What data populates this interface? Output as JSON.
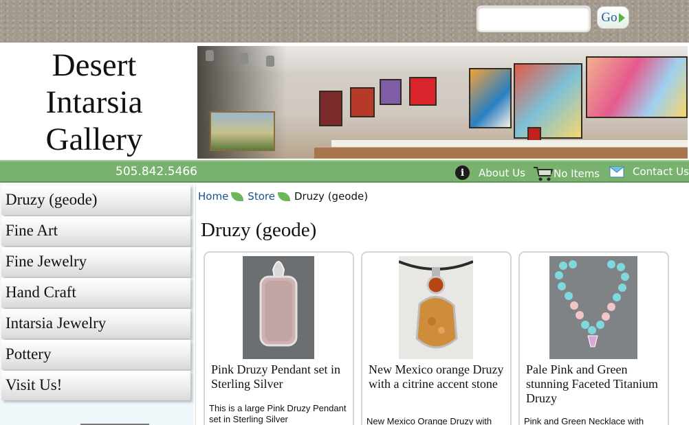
{
  "search": {
    "placeholder": "",
    "go_label": "Go"
  },
  "site": {
    "logo_lines": [
      "Desert",
      "Intarsia",
      "Gallery"
    ]
  },
  "topnav": {
    "phone": "505.842.5466",
    "about": "About Us",
    "cart": "No Items",
    "contact": "Contact Us"
  },
  "sidebar": {
    "items": [
      {
        "label": "Druzy (geode)"
      },
      {
        "label": "Fine Art"
      },
      {
        "label": "Fine Jewelry"
      },
      {
        "label": "Hand Craft"
      },
      {
        "label": "Intarsia Jewelry"
      },
      {
        "label": "Pottery"
      },
      {
        "label": "Visit Us!"
      }
    ]
  },
  "breadcrumb": {
    "home": "Home",
    "store": "Store",
    "current": "Druzy (geode)"
  },
  "page": {
    "title": "Druzy (geode)"
  },
  "products": [
    {
      "title": "Pink Druzy Pendant set in Sterling Silver",
      "description": "This is a large Pink Druzy Pendant set in Sterling Silver"
    },
    {
      "title": "New Mexico orange Druzy with a citrine accent stone",
      "description": "New Mexico Orange Druzy with"
    },
    {
      "title": "Pale Pink and Green stunning Faceted Titanium Druzy",
      "description": "Pink and Green Necklace with"
    }
  ],
  "colors": {
    "nav_green": "#79b26f",
    "link_blue": "#1d4f91",
    "sidebar_bg": "#eef8fa"
  }
}
